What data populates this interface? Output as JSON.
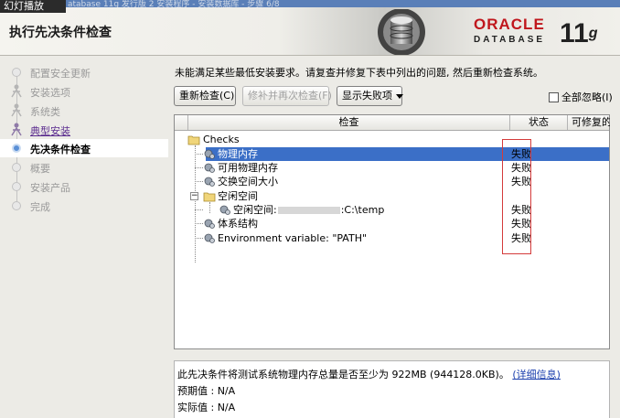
{
  "overlay": {
    "slideshow_label": "幻灯播放"
  },
  "window": {
    "title_partial": "atabase 11g 发行版 2 安装程序 - 安装数据库 - 步骤 6/8"
  },
  "header": {
    "page_title": "执行先决条件检查",
    "brand": "ORACLE",
    "product": "DATABASE",
    "version": "11",
    "version_suffix": "g"
  },
  "sidebar": {
    "steps": [
      {
        "label": "配置安全更新",
        "state": "done"
      },
      {
        "label": "安装选项",
        "state": "done"
      },
      {
        "label": "系统类",
        "state": "done"
      },
      {
        "label": "典型安装",
        "state": "link"
      },
      {
        "label": "先决条件检查",
        "state": "active"
      },
      {
        "label": "概要",
        "state": "pending"
      },
      {
        "label": "安装产品",
        "state": "pending"
      },
      {
        "label": "完成",
        "state": "pending"
      }
    ]
  },
  "main": {
    "intro": "未能满足某些最低安装要求。请复查并修复下表中列出的问题, 然后重新检查系统。",
    "buttons": {
      "recheck": "重新检查(C)",
      "fix_and_check": "修补并再次检查(F)",
      "show_failed": "显示失败项"
    },
    "ignore_all": "全部忽略(I)",
    "table": {
      "headers": {
        "check": "检查",
        "status": "状态",
        "fixable": "可修复的"
      },
      "rows": [
        {
          "label": "Checks",
          "status": ""
        },
        {
          "label": "物理内存",
          "status": "失败"
        },
        {
          "label": "可用物理内存",
          "status": "失败"
        },
        {
          "label": "交换空间大小",
          "status": "失败"
        },
        {
          "label": "空闲空间",
          "status": ""
        },
        {
          "label_prefix": "空闲空间:",
          "label_suffix": ":C:\\temp",
          "status": "失败"
        },
        {
          "label": "体系结构",
          "status": "失败"
        },
        {
          "label": "Environment variable: \"PATH\"",
          "status": "失败"
        }
      ]
    },
    "details": {
      "message": "此先决条件将测试系统物理内存总量是否至少为 922MB (944128.0KB)。",
      "more_link": "(详细信息)",
      "expected": "预期值 : N/A",
      "actual": "实际值 : N/A"
    }
  },
  "colors": {
    "oracle_red": "#c0171d",
    "selection_blue": "#3b6fc7",
    "highlight_red": "#d43b3b",
    "link_purple": "#5b2c8f"
  }
}
